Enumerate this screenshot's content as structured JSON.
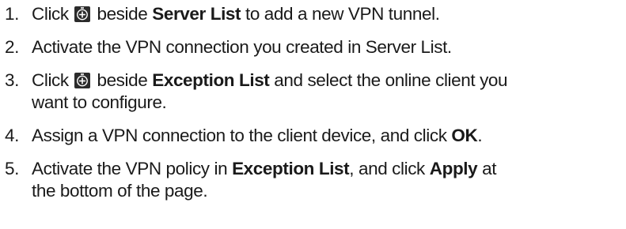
{
  "steps": [
    {
      "number": "1.",
      "pre": "Click ",
      "icon": "add-circle-icon",
      "mid": " beside ",
      "bold": "Server List",
      "post": " to add a new VPN tunnel."
    },
    {
      "number": "2.",
      "text": "Activate the VPN connection you created in Server List."
    },
    {
      "number": "3.",
      "pre": "Click ",
      "icon": "add-circle-icon",
      "mid": " beside ",
      "bold": "Exception List",
      "post_line1": " and select the online client you",
      "line2": "want to configure."
    },
    {
      "number": "4.",
      "pre": "Assign a VPN connection to the client device, and click ",
      "bold": "OK",
      "post": "."
    },
    {
      "number": "5.",
      "pre": "Activate the VPN policy in ",
      "bold1": "Exception List",
      "mid": ", and click ",
      "bold2": "Apply",
      "post_line1": " at",
      "line2": "the bottom of the page."
    }
  ],
  "colors": {
    "text": "#1a1a1a",
    "icon_bg": "#2b2b2b",
    "icon_fg": "#ffffff"
  }
}
